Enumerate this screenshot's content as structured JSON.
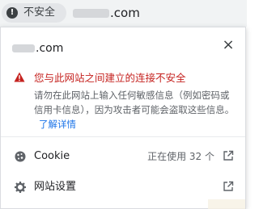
{
  "address_bar": {
    "security_label": "不安全",
    "url_suffix": ".com"
  },
  "popup": {
    "site_suffix": ".com",
    "alert_title": "您与此网站之间建立的连接不安全",
    "alert_body": "请勿在此网站上输入任何敏感信息（例如密码或信用卡信息），因为攻击者可能会盗取这些信息。",
    "learn_more": "了解详情",
    "cookie": {
      "label": "Cookie",
      "status": "正在使用 32 个"
    },
    "site_settings": {
      "label": "网站设置"
    }
  },
  "colors": {
    "warning": "#c5221f",
    "link": "#1a73e8",
    "text": "#202124",
    "secondary_text": "#5f6368"
  }
}
